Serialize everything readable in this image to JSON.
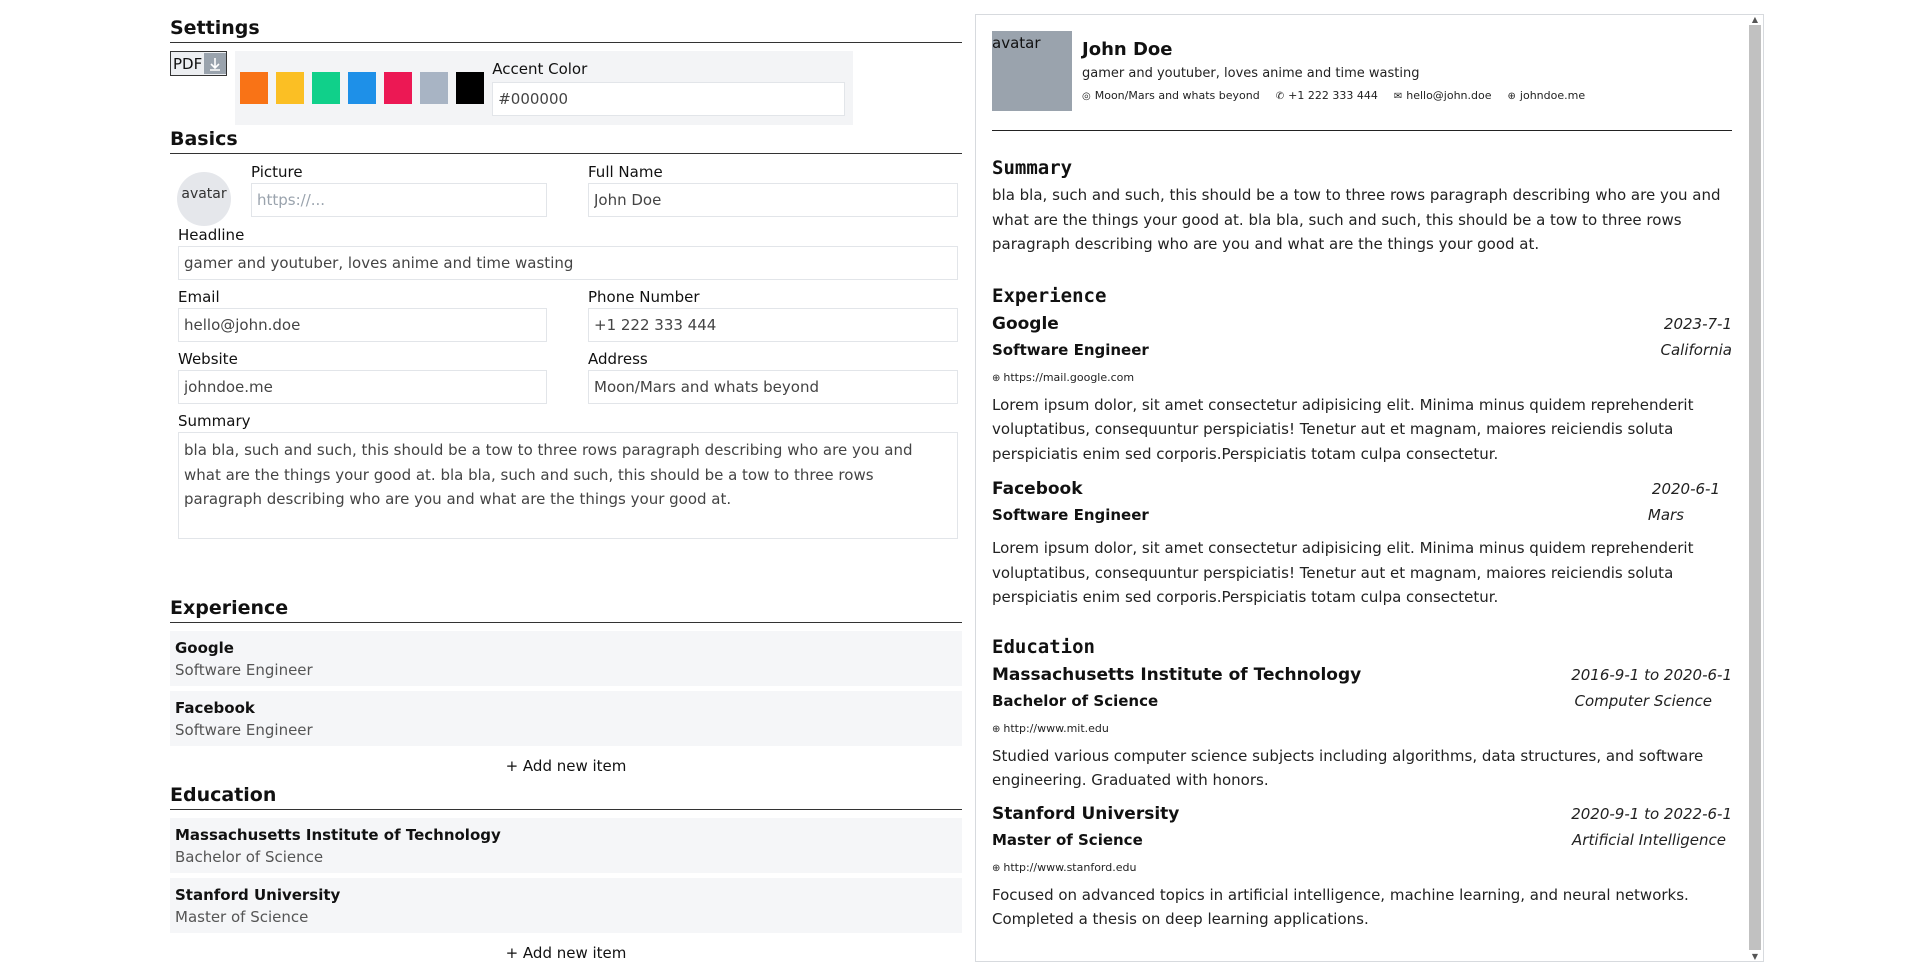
{
  "settings": {
    "title": "Settings",
    "pdf_label": "PDF",
    "pdf_icon": "download-icon",
    "accent_label": "Accent Color",
    "accent_value": "#000000",
    "swatches": [
      "#f97316",
      "#fbbf24",
      "#10d08a",
      "#1e90e8",
      "#ec1854",
      "#a8b4c4",
      "#000000"
    ]
  },
  "basics": {
    "title": "Basics",
    "avatar_alt": "avatar",
    "picture_label": "Picture",
    "picture_placeholder": "https://...",
    "fullname_label": "Full Name",
    "fullname_value": "John Doe",
    "headline_label": "Headline",
    "headline_value": "gamer and youtuber, loves anime and time wasting",
    "email_label": "Email",
    "email_value": "hello@john.doe",
    "phone_label": "Phone Number",
    "phone_value": "+1 222 333 444",
    "website_label": "Website",
    "website_value": "johndoe.me",
    "address_label": "Address",
    "address_value": "Moon/Mars and whats beyond",
    "summary_label": "Summary",
    "summary_value": "bla bla, such and such, this should be a tow to three rows paragraph describing who are you and what are the things your good at. bla bla, such and such, this should be a tow to three rows paragraph describing who are you and what are the things your good at."
  },
  "experience": {
    "title": "Experience",
    "items": [
      {
        "title": "Google",
        "subtitle": "Software Engineer"
      },
      {
        "title": "Facebook",
        "subtitle": "Software Engineer"
      }
    ],
    "add_label": "+ Add new item"
  },
  "education": {
    "title": "Education",
    "items": [
      {
        "title": "Massachusetts Institute of Technology",
        "subtitle": "Bachelor of Science"
      },
      {
        "title": "Stanford University",
        "subtitle": "Master of Science"
      }
    ],
    "add_label": "+ Add new item"
  },
  "preview": {
    "avatar_alt": "avatar",
    "name": "John Doe",
    "headline": "gamer and youtuber, loves anime and time wasting",
    "address": "Moon/Mars and whats beyond",
    "phone": "+1 222 333 444",
    "email": "hello@john.doe",
    "website": "johndoe.me",
    "summary_title": "Summary",
    "summary": "bla bla, such and such, this should be a tow to three rows paragraph describing who are you and what are the things your good at. bla bla, such and such, this should be a tow to three rows paragraph describing who are you and what are the things your good at.",
    "experience_title": "Experience",
    "experience": [
      {
        "org": "Google",
        "date": "2023-7-1",
        "role": "Software Engineer",
        "location": "California",
        "url": "https://mail.google.com",
        "desc": "Lorem ipsum dolor, sit amet consectetur adipisicing elit. Minima minus quidem reprehenderit voluptatibus, consequuntur perspiciatis! Tenetur aut et magnam, maiores reiciendis soluta perspiciatis enim sed corporis.Perspiciatis totam culpa consectetur."
      },
      {
        "org": "Facebook",
        "date": "2020-6-1",
        "role": "Software Engineer",
        "location": "Mars",
        "desc": "Lorem ipsum dolor, sit amet consectetur adipisicing elit. Minima minus quidem reprehenderit voluptatibus, consequuntur perspiciatis! Tenetur aut et magnam, maiores reiciendis soluta perspiciatis enim sed corporis.Perspiciatis totam culpa consectetur."
      }
    ],
    "education_title": "Education",
    "education": [
      {
        "org": "Massachusetts Institute of Technology",
        "date": "2016-9-1 to 2020-6-1",
        "degree": "Bachelor of Science",
        "field": "Computer Science",
        "url": "http://www.mit.edu",
        "desc": "Studied various computer science subjects including algorithms, data structures, and software engineering. Graduated with honors."
      },
      {
        "org": "Stanford University",
        "date": "2020-9-1 to 2022-6-1",
        "degree": "Master of Science",
        "field": "Artificial Intelligence",
        "url": "http://www.stanford.edu",
        "desc": "Focused on advanced topics in artificial intelligence, machine learning, and neural networks. Completed a thesis on deep learning applications."
      }
    ]
  }
}
